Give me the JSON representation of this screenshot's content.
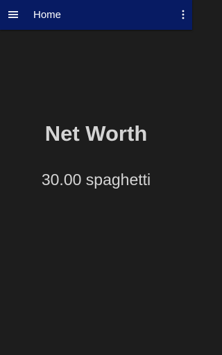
{
  "app_bar": {
    "title": "Home",
    "menu_icon": "hamburger-menu-icon",
    "overflow_icon": "more-vertical-icon",
    "background_color": "#071b63"
  },
  "main": {
    "heading": "Net Worth",
    "amount": "30.00 spaghetti",
    "background_color": "#1d1d1d",
    "text_color": "#d4d4d4"
  }
}
